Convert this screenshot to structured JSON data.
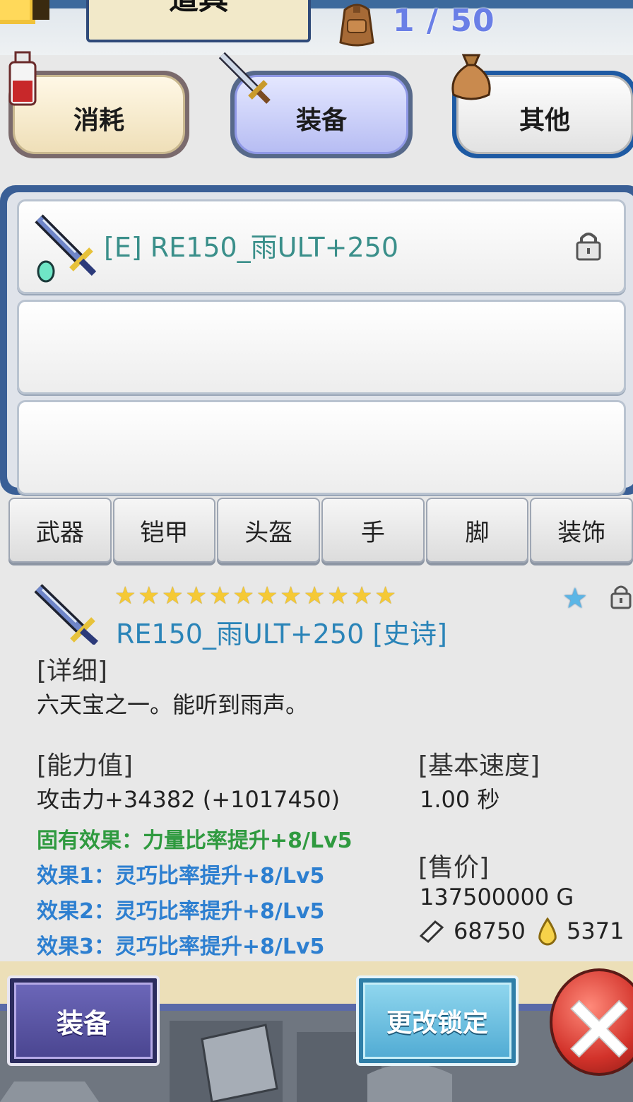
{
  "header": {
    "title": "道具",
    "bag_count": "1 / 50"
  },
  "categories": {
    "consume": "消耗",
    "equip": "装备",
    "other": "其他"
  },
  "item_list": {
    "items": [
      {
        "name": "[E] RE150_雨ULT+250"
      }
    ]
  },
  "subtabs": [
    "武器",
    "铠甲",
    "头盔",
    "手",
    "脚",
    "装饰"
  ],
  "detail": {
    "stars": [
      "★",
      "★",
      "★",
      "★",
      "★",
      "★",
      "★",
      "★",
      "★",
      "★",
      "★",
      "★"
    ],
    "blue_star": "★",
    "title": "RE150_雨ULT+250 [史诗]",
    "details_label": "[详细]",
    "description": "六天宝之一。能听到雨声。",
    "stats_label": "[能力值]",
    "attack": "攻击力+34382 (+1017450)",
    "inherent_effect": "固有效果：力量比率提升+8/Lv5",
    "effect1": "效果1：灵巧比率提升+8/Lv5",
    "effect2": "效果2：灵巧比率提升+8/Lv5",
    "effect3": "效果3：灵巧比率提升+8/Lv5",
    "speed_label": "[基本速度]",
    "speed": "1.00 秒",
    "price_label": "[售价]",
    "price": "137500000 G",
    "whetstone_count": "68750",
    "drop_count": "5371"
  },
  "buttons": {
    "equip": "装备",
    "change_lock": "更改锁定"
  },
  "colors": {
    "accent_blue": "#2a84b8",
    "inherent_green": "#2f9a3f",
    "effect_blue": "#2d7fd0",
    "frame_blue": "#3a5f96"
  }
}
